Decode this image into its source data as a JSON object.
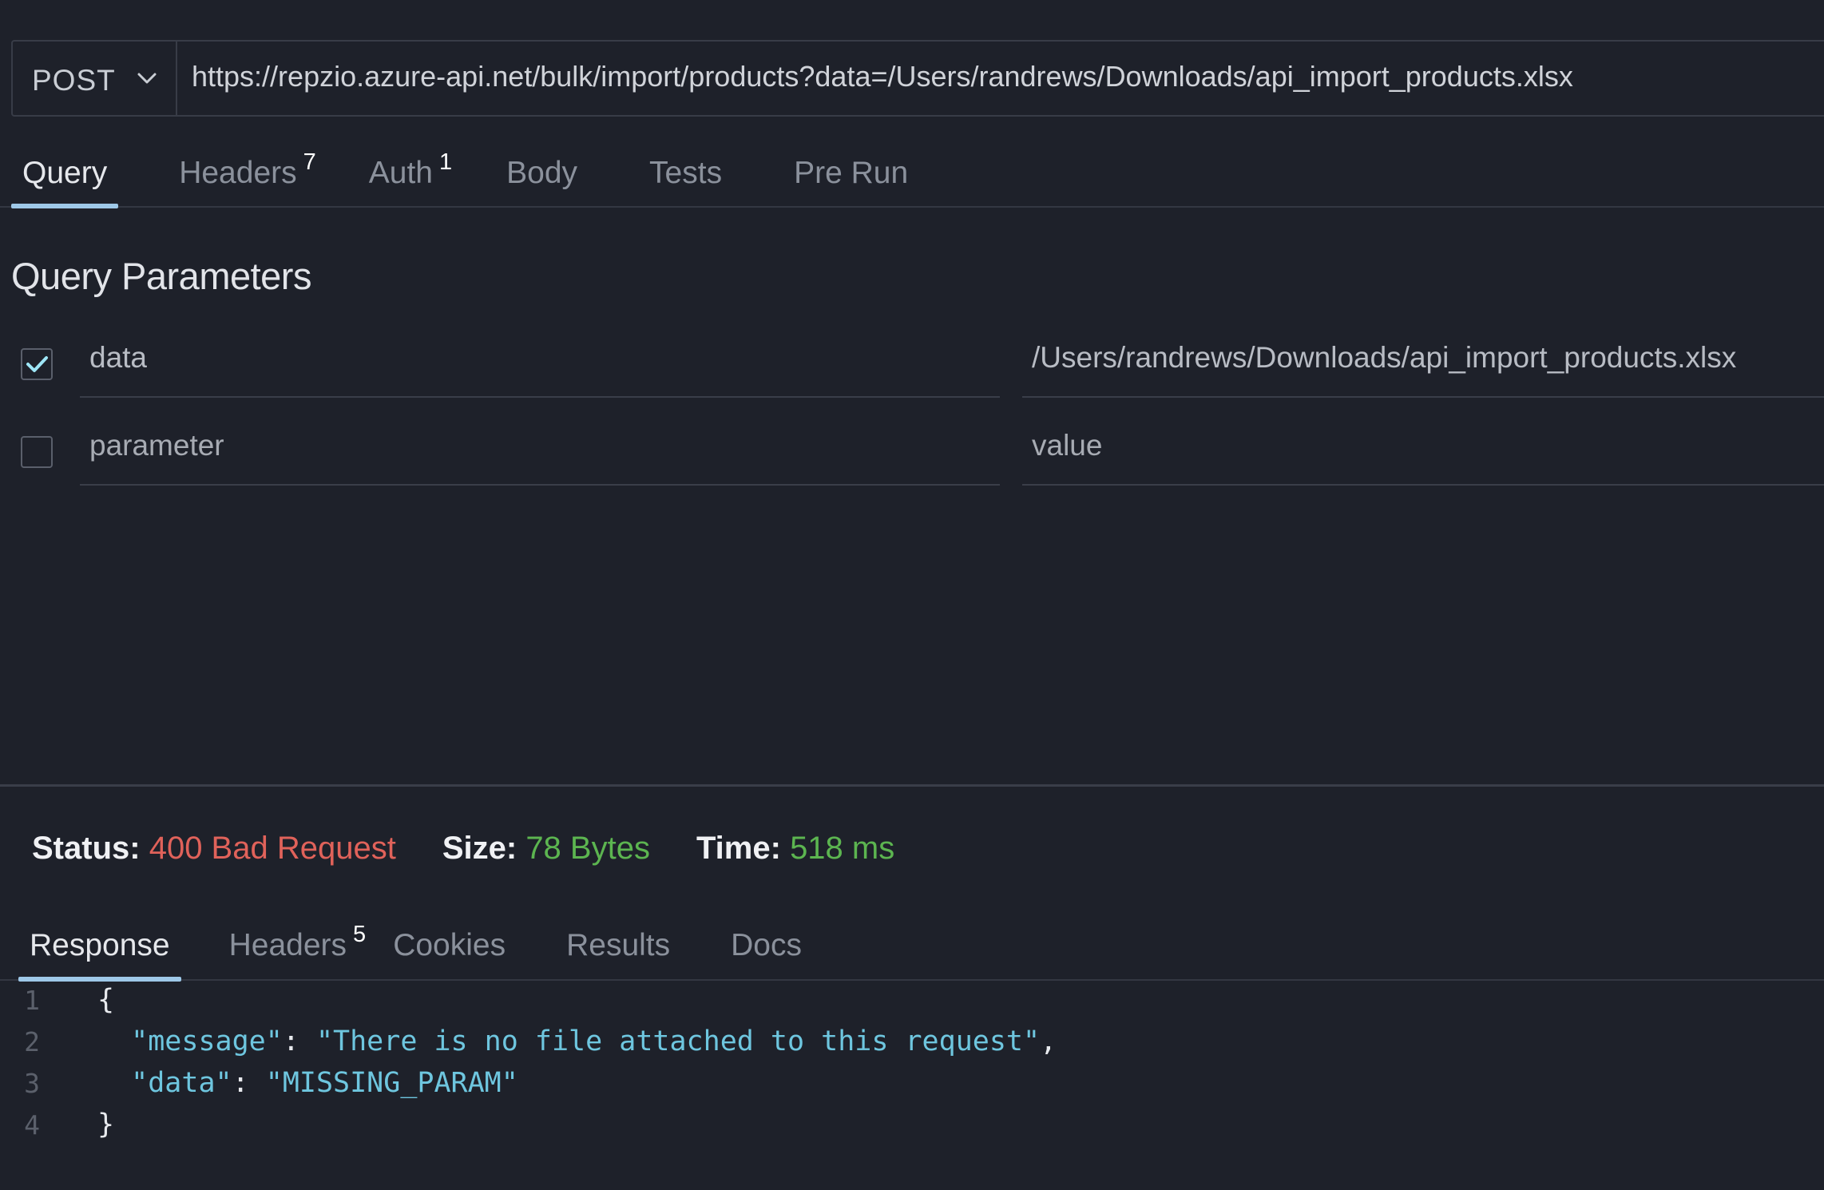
{
  "request": {
    "method": "POST",
    "url": "https://repzio.azure-api.net/bulk/import/products?data=/Users/randrews/Downloads/api_import_products.xlsx"
  },
  "request_tabs": [
    {
      "label": "Query",
      "badge": "",
      "active": true
    },
    {
      "label": "Headers",
      "badge": "7",
      "active": false
    },
    {
      "label": "Auth",
      "badge": "1",
      "active": false
    },
    {
      "label": "Body",
      "badge": "",
      "active": false
    },
    {
      "label": "Tests",
      "badge": "",
      "active": false
    },
    {
      "label": "Pre Run",
      "badge": "",
      "active": false
    }
  ],
  "query": {
    "title": "Query Parameters",
    "params": [
      {
        "checked": true,
        "key": "data",
        "value": "/Users/randrews/Downloads/api_import_products.xlsx"
      },
      {
        "checked": false,
        "key_placeholder": "parameter",
        "value_placeholder": "value"
      }
    ]
  },
  "status": {
    "status_label": "Status:",
    "status_value": "400 Bad Request",
    "size_label": "Size:",
    "size_value": "78 Bytes",
    "time_label": "Time:",
    "time_value": "518 ms",
    "colors": {
      "error": "#e0625a",
      "ok": "#5cb550"
    }
  },
  "response_tabs": [
    {
      "label": "Response",
      "badge": "",
      "active": true
    },
    {
      "label": "Headers",
      "badge": "5",
      "active": false
    },
    {
      "label": "Cookies",
      "badge": "",
      "active": false
    },
    {
      "label": "Results",
      "badge": "",
      "active": false
    },
    {
      "label": "Docs",
      "badge": "",
      "active": false
    }
  ],
  "response_body": {
    "line_numbers": [
      "1",
      "2",
      "3",
      "4"
    ],
    "open_brace": "{",
    "close_brace": "}",
    "message_key": "\"message\"",
    "message_value": "\"There is no file attached to this request\"",
    "data_key": "\"data\"",
    "data_value": "\"MISSING_PARAM\"",
    "colon": ": ",
    "comma": ","
  },
  "icons": {
    "method_dropdown": "chevron-down-icon",
    "param_checked": "checkmark-icon"
  }
}
